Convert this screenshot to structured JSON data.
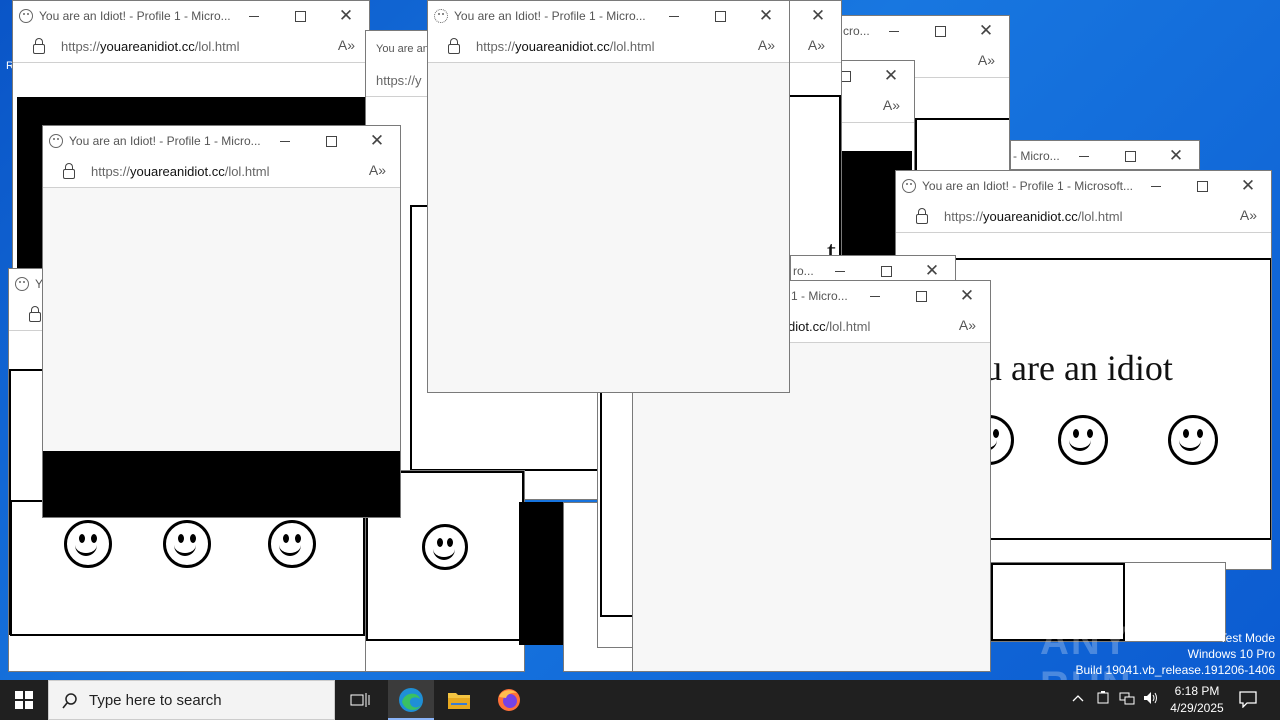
{
  "browser": {
    "title_full": "You are an Idiot! - Profile 1 - Microsoft...",
    "title_short": "You are an Idiot! - Profile 1 - Micro...",
    "url_scheme": "https://",
    "url_host": "youareanidiot.cc",
    "url_path": "/lol.html",
    "url_partial": "https://y",
    "url_tail_host": "diot.cc",
    "title_frag_micro": "- Micro...",
    "title_frag_cro": "cro...",
    "title_frag_ro": "ro...",
    "title_frag_1micro": "1 - Micro...",
    "title_frag_yo": "Yo",
    "title_frag_small": "You are an Idio",
    "url_frag_lhtml": "l.html"
  },
  "page": {
    "idiot_text": "u are an idiot",
    "idiot_text_partial": "t"
  },
  "desktop": {
    "icon_partial": "R"
  },
  "taskbar": {
    "search_placeholder": "Type here to search",
    "time": "6:18 PM",
    "date": "4/29/2025"
  },
  "watermark": {
    "brand": "ANY RUN",
    "line1": "Test Mode",
    "line2": "Windows 10 Pro",
    "line3": "Build 19041.vb_release.191206-1406"
  }
}
